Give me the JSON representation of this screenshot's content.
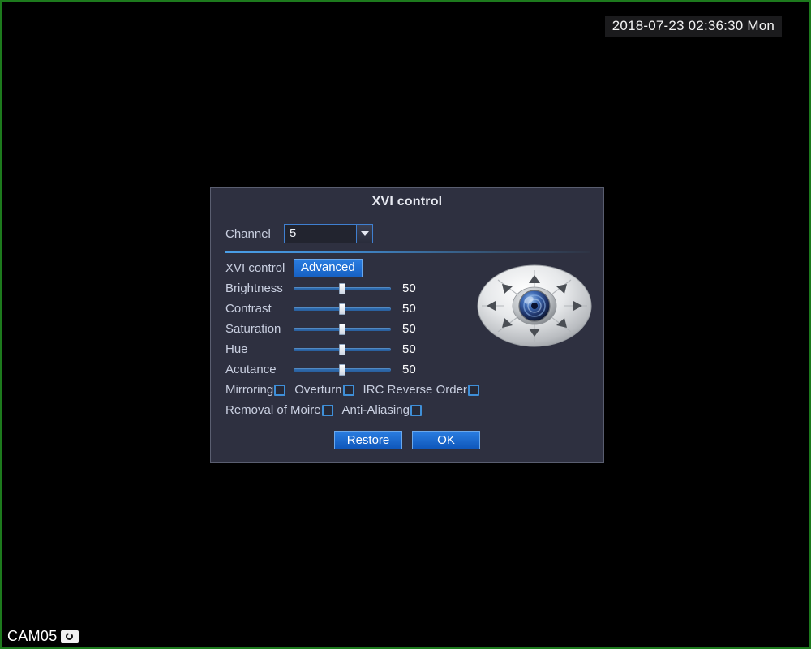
{
  "osd": {
    "timestamp": "2018-07-23 02:36:30 Mon",
    "camera_label": "CAM05",
    "record_icon": "camera-icon",
    "border_color": "#1d7a1d"
  },
  "dialog": {
    "title": "XVI control",
    "channel": {
      "label": "Channel",
      "value": "5",
      "arrow_icon": "chevron-down-icon"
    },
    "mode": {
      "label": "XVI control",
      "button_label": "Advanced"
    },
    "sliders": [
      {
        "label": "Brightness",
        "value": "50",
        "percent": 50
      },
      {
        "label": "Contrast",
        "value": "50",
        "percent": 50
      },
      {
        "label": "Saturation",
        "value": "50",
        "percent": 50
      },
      {
        "label": "Hue",
        "value": "50",
        "percent": 50
      },
      {
        "label": "Acutance",
        "value": "50",
        "percent": 50
      }
    ],
    "checkbox_rows": [
      [
        {
          "label": "Mirroring",
          "checked": false
        },
        {
          "label": "Overturn",
          "checked": false
        },
        {
          "label": "IRC Reverse Order",
          "checked": false
        }
      ],
      [
        {
          "label": "Removal of Moire",
          "checked": false
        },
        {
          "label": "Anti-Aliasing",
          "checked": false
        }
      ]
    ],
    "ptz": {
      "name": "ptz-direction-wheel",
      "directions": [
        "up",
        "up-right",
        "right",
        "down-right",
        "down",
        "down-left",
        "left",
        "up-left"
      ],
      "center_icon": "camera-lens-icon"
    },
    "buttons": {
      "restore": "Restore",
      "ok": "OK"
    },
    "colors": {
      "panel": "#2e3040",
      "accent": "#2a7de0",
      "text": "#c9cfe0"
    }
  }
}
